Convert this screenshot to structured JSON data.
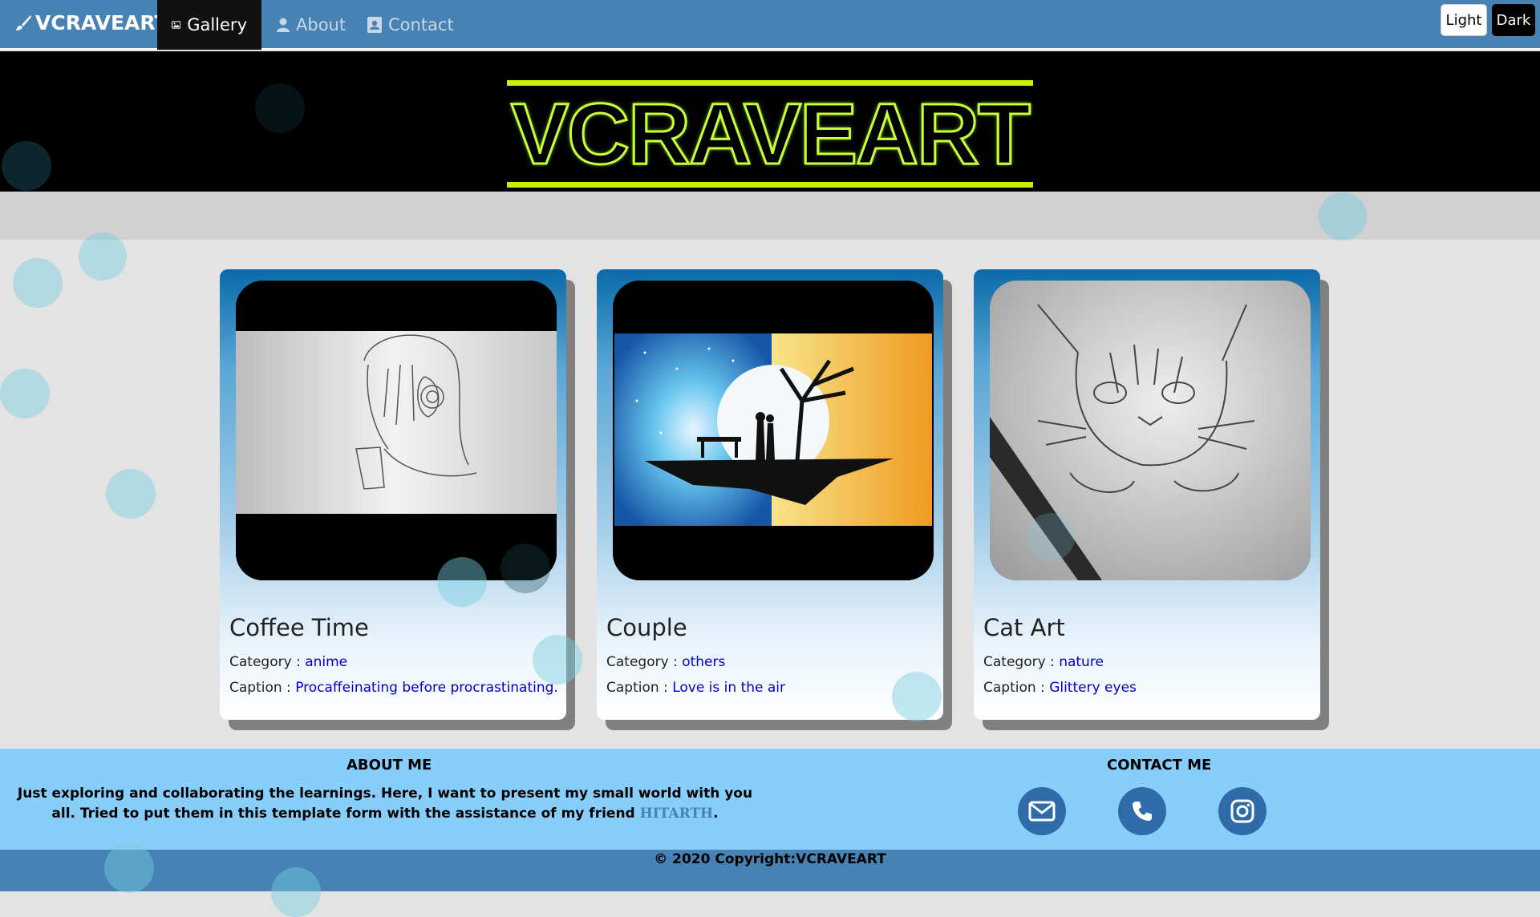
{
  "navbar": {
    "brand": "VCRAVEART",
    "items": [
      {
        "label": "Gallery",
        "icon": "image-icon",
        "active": true
      },
      {
        "label": "About",
        "icon": "user-icon"
      },
      {
        "label": "Contact",
        "icon": "contact-card-icon"
      }
    ],
    "theme_light": "Light",
    "theme_dark": "Dark"
  },
  "hero": {
    "logo_text": "VCRAVEART",
    "accent_color": "#c8f000"
  },
  "labels": {
    "category": "Category : ",
    "caption": "Caption : "
  },
  "cards": [
    {
      "title": "Coffee Time",
      "category": "anime",
      "caption": "Procaffeinating before procrastinating."
    },
    {
      "title": "Couple",
      "category": "others",
      "caption": "Love is in the air"
    },
    {
      "title": "Cat Art",
      "category": "nature",
      "caption": "Glittery eyes"
    }
  ],
  "footer": {
    "about_title": "ABOUT ME",
    "about_text": "Just exploring and collaborating the learnings. Here, I want to present my small world with you all. Tried to put them in this template form with the assistance of my friend ",
    "friend": "HITARTH",
    "about_end": ".",
    "contact_title": "CONTACT ME",
    "contact_icons": [
      "envelope-icon",
      "phone-icon",
      "instagram-icon"
    ],
    "copyright": "© 2020 Copyright:VCRAVEART"
  },
  "colors": {
    "nav": "#4682b4",
    "footer": "#87cefa",
    "link": "#0000cd"
  }
}
